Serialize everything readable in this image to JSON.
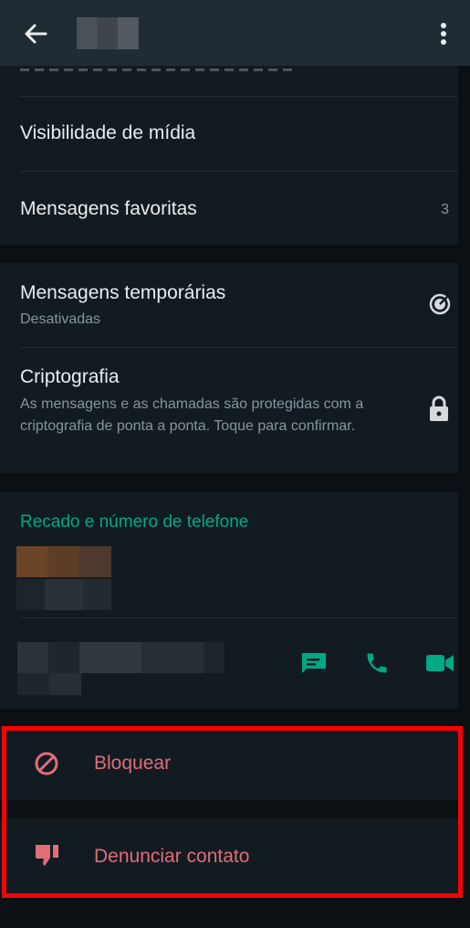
{
  "appbar": {
    "back_icon": "arrow-left-icon",
    "menu_icon": "more-vertical-icon"
  },
  "settings": {
    "media_visibility": "Visibilidade de mídia",
    "starred_messages": "Mensagens favoritas",
    "starred_count": "3",
    "disappearing_title": "Mensagens temporárias",
    "disappearing_status": "Desativadas",
    "encryption_title": "Criptografia",
    "encryption_desc": "As mensagens e as chamadas são protegidas com a criptografia de ponta a ponta. Toque para confirmar."
  },
  "about": {
    "section_title": "Recado e número de telefone",
    "message_icon": "message-icon",
    "call_icon": "phone-icon",
    "video_icon": "video-camera-icon"
  },
  "actions": {
    "block_label": "Bloquear",
    "block_icon": "block-icon",
    "report_label": "Denunciar contato",
    "report_icon": "thumbs-down-icon"
  },
  "colors": {
    "accent": "#00a884",
    "danger": "#e26d79",
    "highlight_frame": "#ff0000"
  }
}
